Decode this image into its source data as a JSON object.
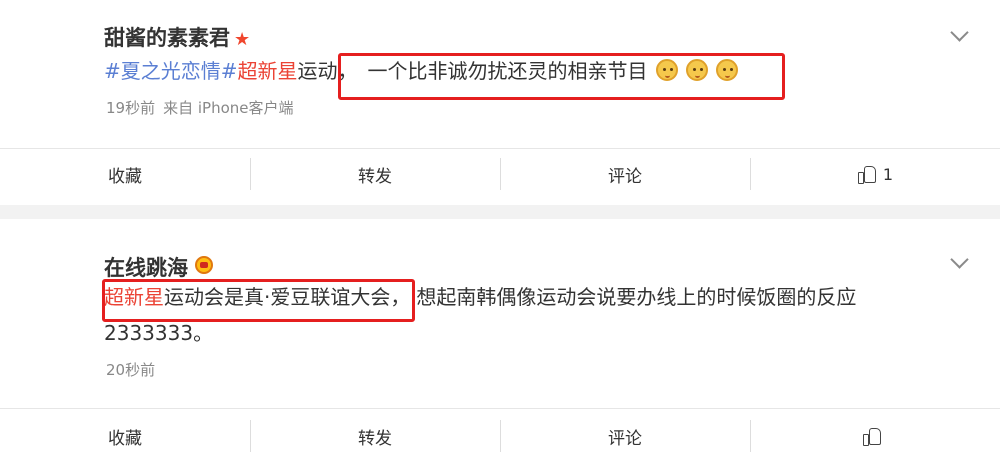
{
  "comments": [
    {
      "username": "甜酱的素素君",
      "text": {
        "tag1": "#夏之光恋情#",
        "tag2": "超新星",
        "plain": "运动，",
        "boxed": "一个比非诚勿扰还灵的相亲节目"
      },
      "emoji_icons": [
        "doge-icon",
        "doge-icon",
        "doge-icon"
      ],
      "time": "19秒前",
      "source": "来自 iPhone客户端",
      "actions": {
        "favorite": "收藏",
        "repost": "转发",
        "comment": "评论",
        "like_count": "1"
      }
    },
    {
      "username": "在线跳海",
      "text": {
        "boxed_red": "超新星",
        "boxed_rest": "运动会是真·爱豆联谊大会，",
        "plain": "想起南韩偶像运动会说要办线上的时候饭圈的反应",
        "line2": "2333333。"
      },
      "time": "20秒前",
      "actions": {
        "favorite": "收藏",
        "repost": "转发",
        "comment": "评论",
        "like_count": ""
      }
    }
  ],
  "colors": {
    "tag": "#5b7fd3",
    "highlight": "#eb4335",
    "box": "#e51f1f"
  }
}
